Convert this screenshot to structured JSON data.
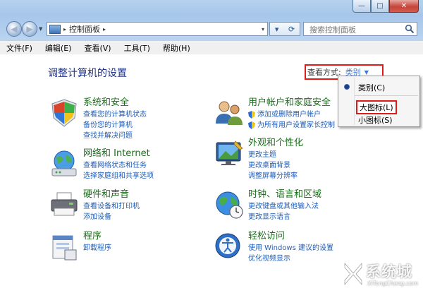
{
  "window": {
    "min_glyph": "—",
    "max_glyph": "□",
    "close_glyph": "✕"
  },
  "toolbar": {
    "breadcrumb_sep": "▸",
    "breadcrumb": "控制面板",
    "breadcrumb_end": "▸",
    "dropdown": "▾",
    "search_placeholder": "搜索控制面板"
  },
  "menubar": [
    "文件(F)",
    "编辑(E)",
    "查看(V)",
    "工具(T)",
    "帮助(H)"
  ],
  "content": {
    "title": "调整计算机的设置",
    "view_by_label": "查看方式:",
    "view_by_value": "类别",
    "view_by_arrow": "▼"
  },
  "categories": [
    {
      "title": "系统和安全",
      "icon": "system-security-icon",
      "links": [
        "查看您的计算机状态",
        "备份您的计算机",
        "查找并解决问题"
      ]
    },
    {
      "title": "网络和 Internet",
      "icon": "network-icon",
      "links": [
        "查看网络状态和任务",
        "选择家庭组和共享选项"
      ]
    },
    {
      "title": "硬件和声音",
      "icon": "hardware-printer-icon",
      "links": [
        "查看设备和打印机",
        "添加设备"
      ]
    },
    {
      "title": "程序",
      "icon": "programs-icon",
      "links": [
        "卸载程序"
      ]
    },
    {
      "title": "用户帐户和家庭安全",
      "icon": "user-accounts-icon",
      "links": [
        "添加或删除用户帐户",
        "为所有用户设置家长控制"
      ]
    },
    {
      "title": "外观和个性化",
      "icon": "appearance-icon",
      "links": [
        "更改主题",
        "更改桌面背景",
        "调整屏幕分辨率"
      ]
    },
    {
      "title": "时钟、语言和区域",
      "icon": "globe-clock-icon",
      "links": [
        "更改键盘或其他输入法",
        "更改显示语言"
      ]
    },
    {
      "title": "轻松访问",
      "icon": "ease-of-access-icon",
      "links": [
        "使用 Windows 建议的设置",
        "优化视频显示"
      ]
    }
  ],
  "popup": {
    "options": [
      "类别(C)",
      "大图标(L)",
      "小图标(S)"
    ],
    "selected": "类别(C)"
  },
  "watermark": {
    "main": "系统城",
    "sub": "XiTongCheng.com"
  },
  "colors": {
    "link": "#1f5db8",
    "category_title": "#1b6d1b",
    "page_title": "#1e3287",
    "highlight_box": "#e01b1b"
  }
}
